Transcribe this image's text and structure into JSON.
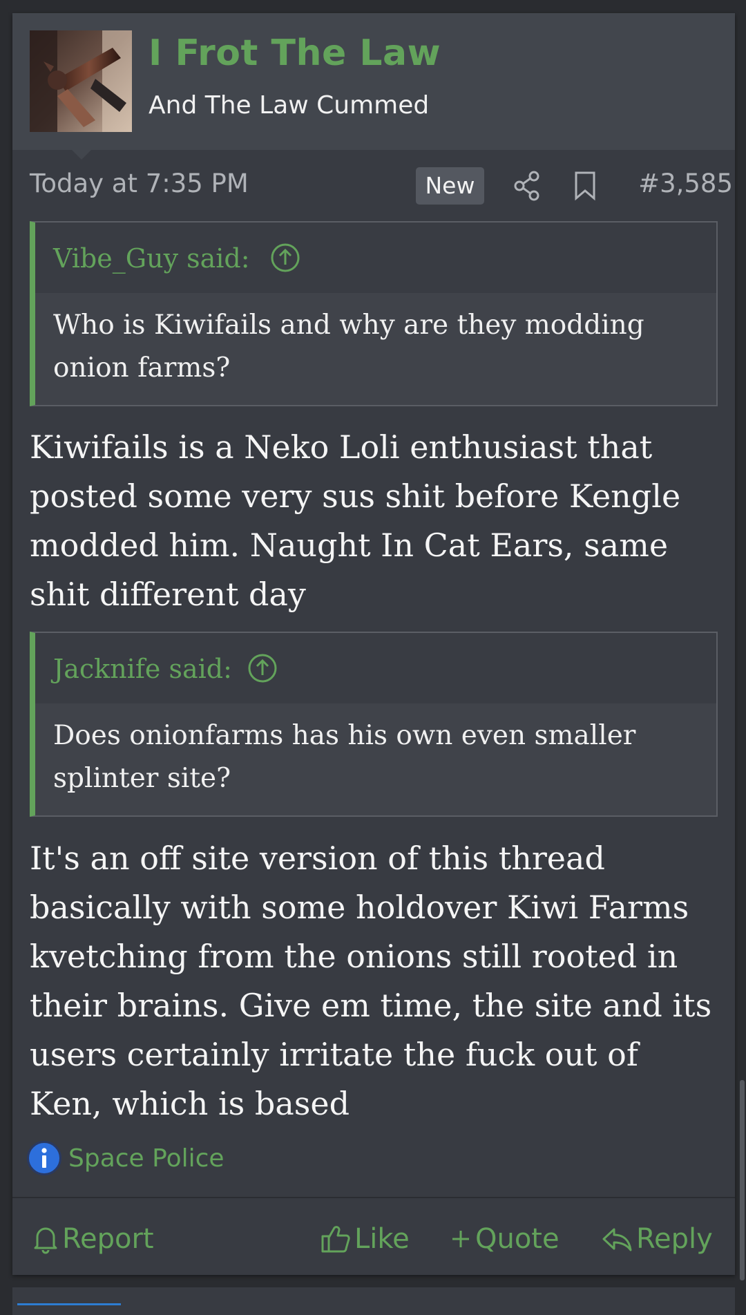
{
  "user": {
    "name": "I Frot The Law",
    "title": "And The Law Cummed"
  },
  "meta": {
    "date": "Today at 7:35 PM",
    "new_badge": "New",
    "post_number": "#3,585",
    "share_icon": "share-icon",
    "bookmark_icon": "bookmark-icon"
  },
  "quotes": [
    {
      "author": "Vibe_Guy said:",
      "text": "Who is Kiwifails and why are they modding onion farms?"
    },
    {
      "author": "Jacknife said:",
      "text": "Does onionfarms has his own even smaller splinter site?"
    }
  ],
  "replies": [
    "Kiwifails is a Neko Loli enthusiast that posted some very sus shit before Kengle modded him. Naught In Cat Ears, same shit different day",
    "It's an off site version of this thread basically with some holdover Kiwi Farms kvetching from the onions still rooted in their brains. Give em time, the site and its users certainly irritate the fuck out of Ken, which is based"
  ],
  "signature": {
    "icon": "info-icon",
    "label": "Space Police"
  },
  "actions": {
    "report": "Report",
    "like": "Like",
    "quote": "Quote",
    "reply": "Reply"
  },
  "colors": {
    "accent_green": "#63a35b",
    "post_bg": "#383b42",
    "header_bg": "#42464d",
    "page_bg": "#2a2c30"
  }
}
